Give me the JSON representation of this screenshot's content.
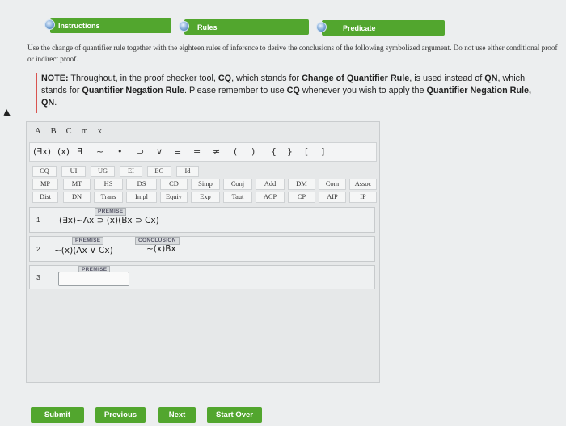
{
  "tabs": [
    {
      "label": "Instructions"
    },
    {
      "label": "Rules"
    },
    {
      "label": "Predicate"
    }
  ],
  "instructions": "Use the change of quantifier rule together with the eighteen rules of inference to derive the conclusions of the following symbolized argument. Do not use either conditional proof or indirect proof.",
  "note": {
    "prefix": "NOTE:",
    "t1": " Throughout, in the proof checker tool, ",
    "b1": "CQ",
    "t2": ", which stands for ",
    "b2": "Change of Quantifier Rule",
    "t3": ", is used instead of ",
    "b3": "QN",
    "t4": ", which stands for ",
    "b4": "Quantifier Negation Rule",
    "t5": ". Please remember to use ",
    "b5": "CQ",
    "t6": " whenever you wish to apply the ",
    "b6": "Quantifier Negation Rule, QN",
    "t7": "."
  },
  "variables": [
    "A",
    "B",
    "C",
    "m",
    "x"
  ],
  "symbols": [
    "(∃x)",
    "(x)",
    "∃",
    "~",
    "•",
    "⊃",
    "∨",
    "≡",
    "=",
    "≠",
    "(",
    ")",
    "{",
    "}",
    "[",
    "]"
  ],
  "rules": {
    "row1": [
      "CQ",
      "UI",
      "UG",
      "EI",
      "EG",
      "Id"
    ],
    "row2": [
      "MP",
      "MT",
      "HS",
      "DS",
      "CD",
      "Simp",
      "Conj",
      "Add",
      "DM",
      "Com",
      "Assoc"
    ],
    "row3": [
      "Dist",
      "DN",
      "Trans",
      "Impl",
      "Equiv",
      "Exp",
      "Taut",
      "ACP",
      "CP",
      "AIP",
      "IP"
    ]
  },
  "proof": {
    "line1": {
      "num": "1",
      "tag": "PREMISE",
      "formula": "(∃x)~Ax ⊃ (x)(Bx ⊃ Cx)"
    },
    "line2": {
      "num": "2",
      "tag": "PREMISE",
      "formula": "~(x)(Ax ∨ Cx)",
      "conc_tag": "CONCLUSION",
      "conclusion": "~(x)Bx"
    },
    "line3": {
      "num": "3",
      "tag": "PREMISE",
      "value": ""
    }
  },
  "buttons": {
    "submit": "Submit",
    "previous": "Previous",
    "next": "Next",
    "start_over": "Start Over"
  }
}
